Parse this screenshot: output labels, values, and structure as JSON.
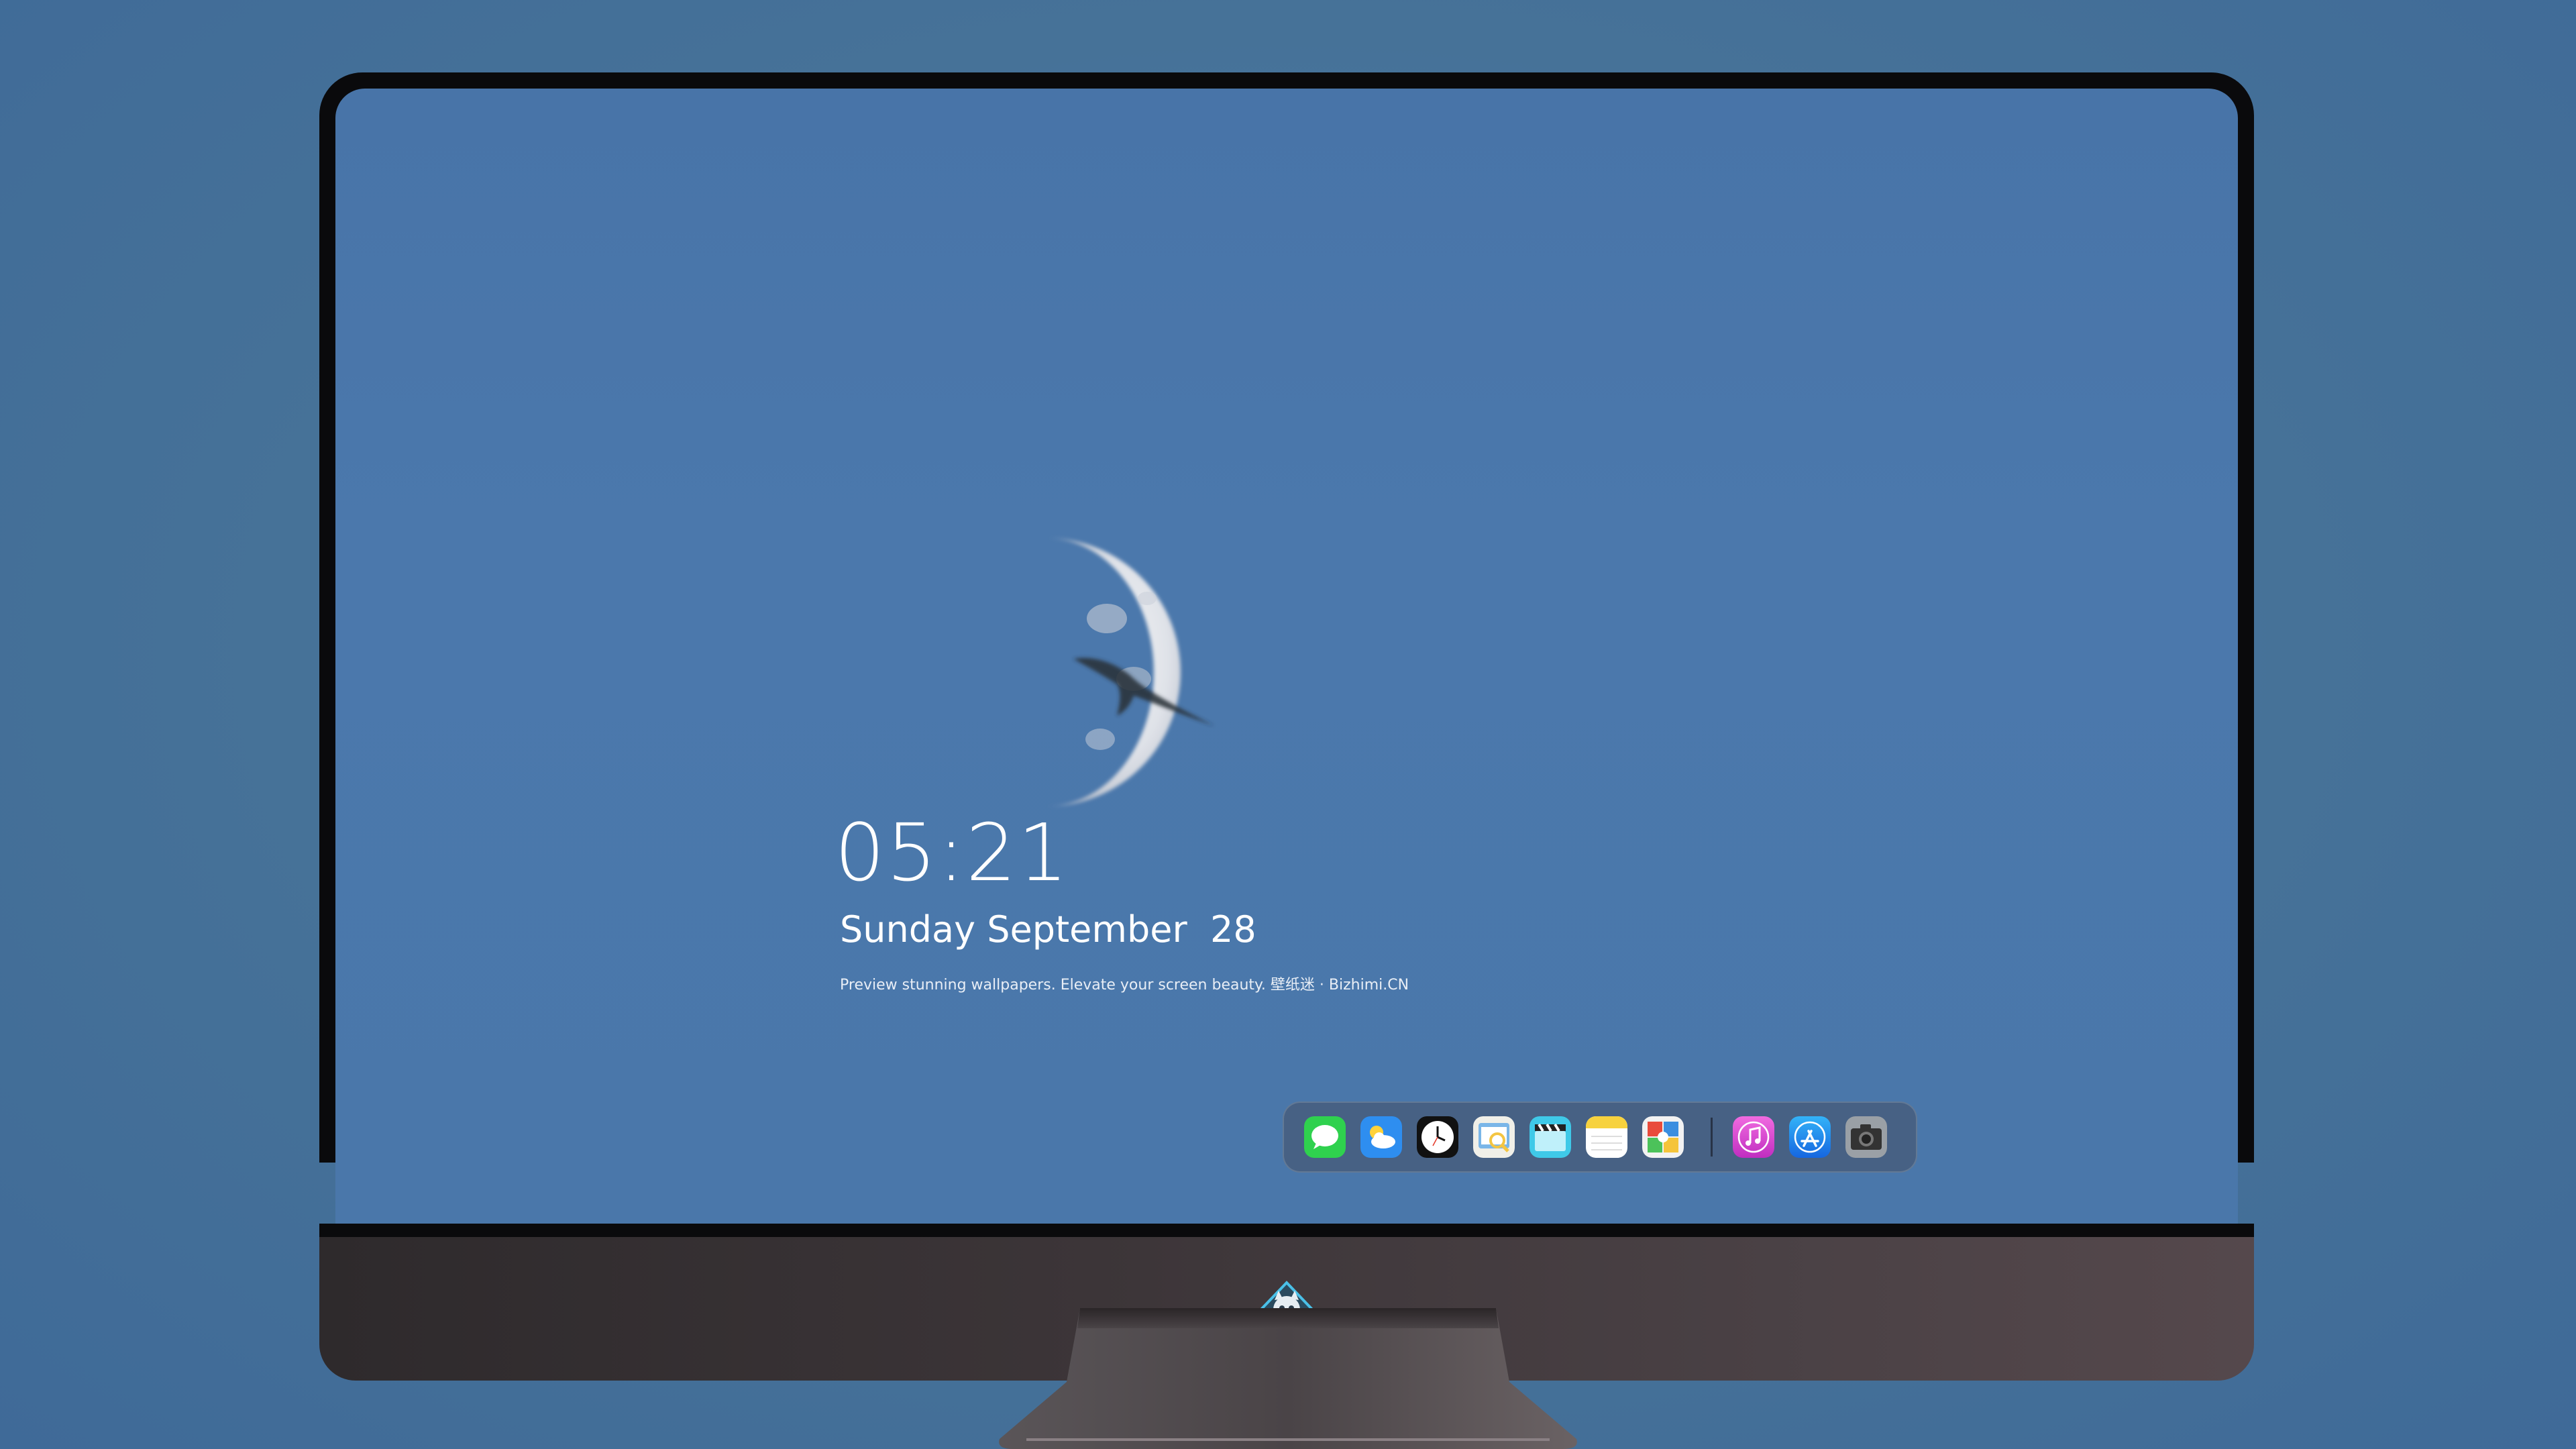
{
  "lockscreen": {
    "time": "05:21",
    "date": "Sunday September  28",
    "tagline": "Preview stunning wallpapers. Elevate your screen beauty. 壁纸迷 · Bizhimi.CN"
  },
  "dock": {
    "items": [
      {
        "name": "messages-icon",
        "color": "#2fd14e"
      },
      {
        "name": "weather-icon",
        "color": "#2e8ef0"
      },
      {
        "name": "clock-icon",
        "color": "#ffffff"
      },
      {
        "name": "preview-icon",
        "color": "#f4c542"
      },
      {
        "name": "clips-icon",
        "color": "#3fc9e8"
      },
      {
        "name": "notes-icon",
        "color": "#f7d23e"
      },
      {
        "name": "photo-booth-icon",
        "color": "#e94b3c"
      },
      {
        "name": "music-icon",
        "color": "#e040c8"
      },
      {
        "name": "app-store-icon",
        "color": "#1e8df2"
      },
      {
        "name": "camera-icon",
        "color": "#555a60"
      }
    ]
  },
  "colors": {
    "background": "#4a76a8",
    "bezel": "#0a0a0c",
    "chin": "#3c3538"
  }
}
